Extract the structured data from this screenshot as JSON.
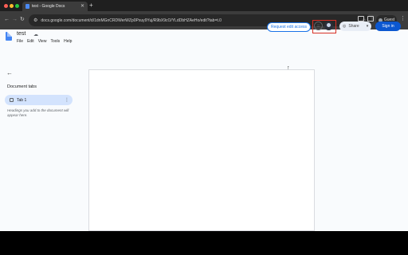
{
  "browser": {
    "tab_title": "test - Google Docs",
    "tab_close_icon": "close-icon",
    "new_tab_icon": "plus-icon",
    "url": "docs.google.com/document/d/1dnMGnCRDWerWZp0Pxuy9Yuj/R9bX9cO/YLdDbHZAeHo/edit?tab=t.0",
    "guest_label": "Guest"
  },
  "docs": {
    "title": "test",
    "menu": [
      "File",
      "Edit",
      "View",
      "Tools",
      "Help"
    ],
    "request_edit_label": "Request edit access",
    "share_label": "Share",
    "signin_label": "Sign in",
    "document_tabs_title": "Document tabs",
    "tabs": [
      {
        "label": "Tab 1"
      }
    ],
    "hint_text": "Headings you add to the document will appear here."
  },
  "colors": {
    "accent": "#1a73e8",
    "signin_bg": "#0b57d0",
    "highlight_box": "#d93025",
    "tab_selected_bg": "#d3e3fd"
  }
}
